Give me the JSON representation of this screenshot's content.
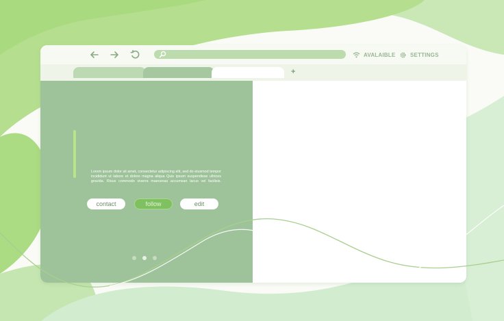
{
  "colors": {
    "accent": "#7fc061",
    "panel": "#9ec39a",
    "background_green": "#b7df92"
  },
  "toolbar": {
    "back_icon": "arrow-left-icon",
    "forward_icon": "arrow-right-icon",
    "reload_icon": "reload-icon",
    "search_icon": "search-icon",
    "wifi_icon": "wifi-icon",
    "wifi_label": "AVALAIBLE",
    "settings_icon": "gear-icon",
    "settings_label": "SETTINGS"
  },
  "tabs": {
    "new_tab_label": "+"
  },
  "content": {
    "paragraph": "Lorem ipsum dolor sit amet, consectetur adipiscing elit, sed do eiusmod tempor incididunt ut labore et dolore magna aliqua Quis ipsum suspendisse ultrices gravida. Risus commodo viverra maecenas accumsan lacus vel facilisis.",
    "buttons": {
      "contact": "contact",
      "follow": "follow",
      "edit": "edit"
    },
    "carousel": {
      "active_index": 2,
      "count": 3
    }
  }
}
